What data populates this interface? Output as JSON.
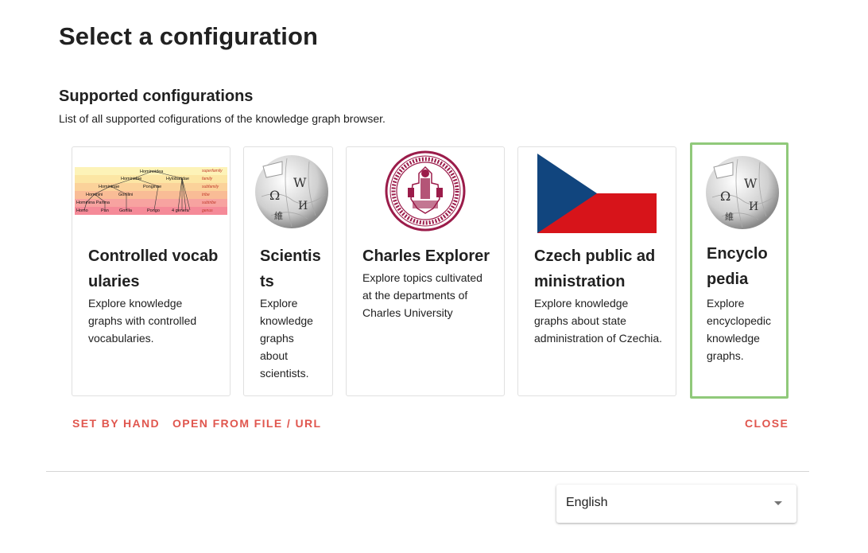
{
  "dialog": {
    "title": "Select a configuration",
    "section_title": "Supported configurations",
    "section_description": "List of all supported cofigurations of the knowledge graph browser."
  },
  "cards": [
    {
      "title": "Controlled vocabularies",
      "description": "Explore knowledge graphs with controlled vocabularies.",
      "image": "taxonomy-diagram",
      "image_text": {
        "nodes": [
          "Hominoidea",
          "Hominidae",
          "Hylobatidae",
          "Homininae",
          "Ponginae",
          "Hominini",
          "Gorillini",
          "Hominina Panina",
          "Homo",
          "Pan",
          "Gorilla",
          "Pongo",
          "4 genera"
        ],
        "ranks": [
          "superfamily",
          "family",
          "subfamily",
          "tribe",
          "subtribe",
          "genus"
        ]
      }
    },
    {
      "title": "Scientists",
      "description": "Explore knowledge graphs about scientists.",
      "image": "wikipedia-globe-icon"
    },
    {
      "title": "Charles Explorer",
      "description": "Explore topics cultivated at the departments of Charles University",
      "image": "charles-university-seal"
    },
    {
      "title": "Czech public administration",
      "description": "Explore knowledge graphs about state administration of Czechia.",
      "image": "czech-flag"
    },
    {
      "title": "Encyclopedia",
      "description": "Explore encyclopedic knowledge graphs.",
      "image": "wikipedia-globe-icon",
      "selected": true
    }
  ],
  "actions": {
    "set_by_hand": "SET BY HAND",
    "open_from_file": "OPEN FROM FILE / URL",
    "close": "CLOSE"
  },
  "language_select": {
    "value": "English"
  },
  "colors": {
    "accent": "#e0564e",
    "selected_border": "#90c97a",
    "flag_blue": "#11457e",
    "flag_red": "#d7141a",
    "seal": "#9b1c4a"
  }
}
